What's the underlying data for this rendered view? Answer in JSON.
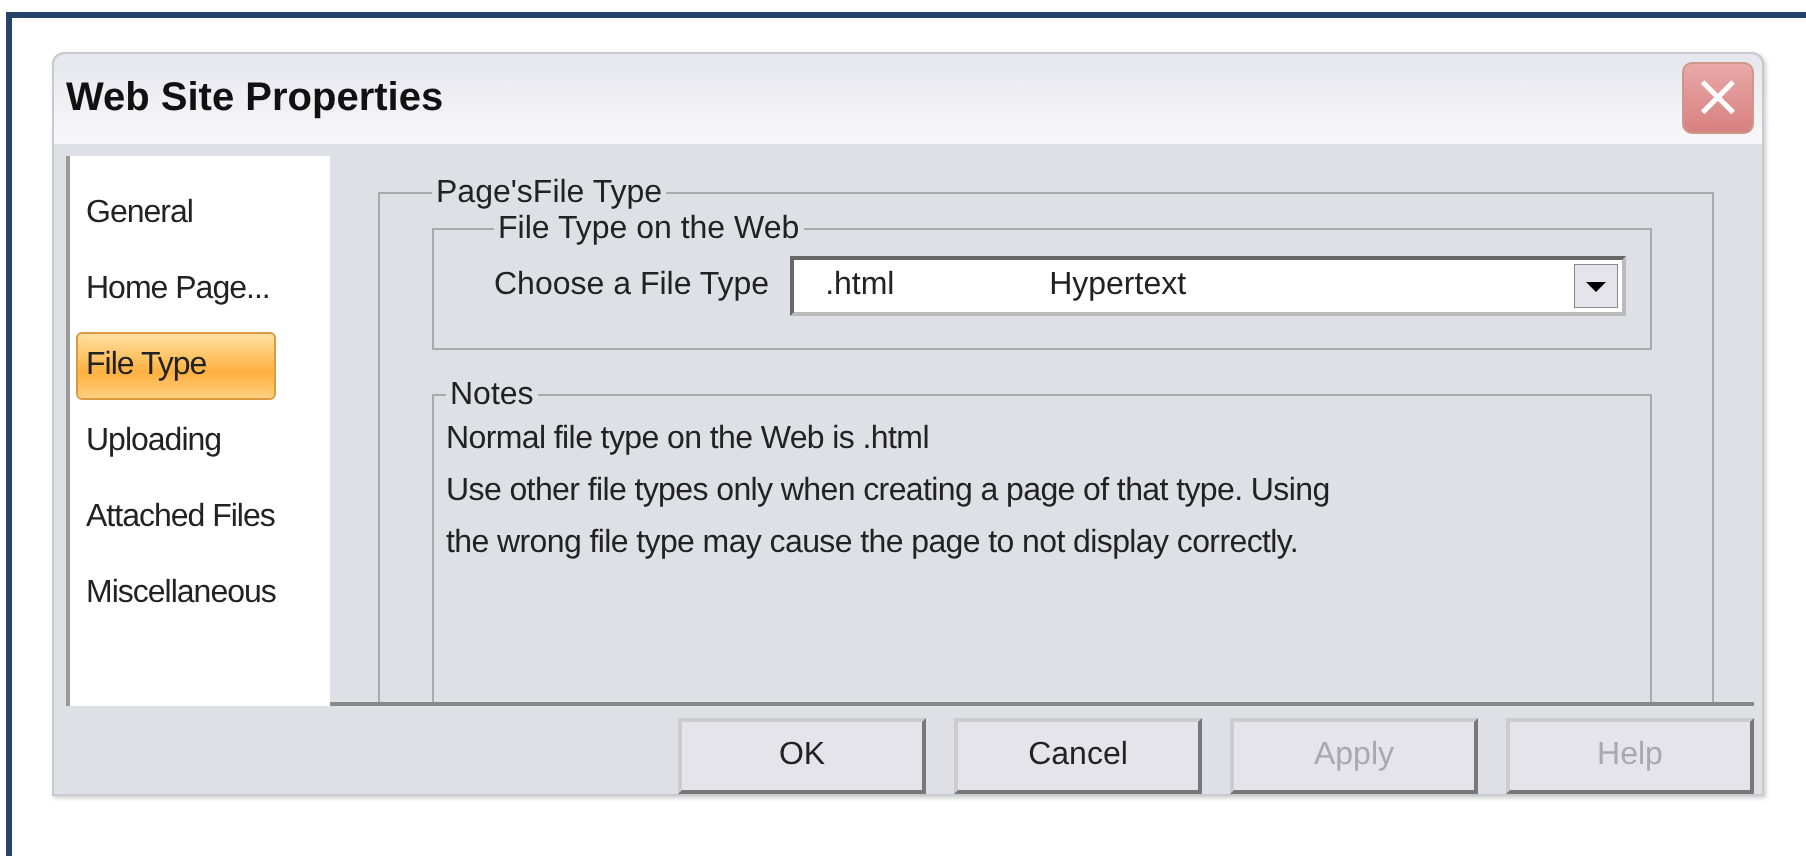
{
  "window": {
    "title": "Web Site Properties",
    "close": "×"
  },
  "sidebar": {
    "items": [
      {
        "label": "General",
        "selected": false
      },
      {
        "label": "Home Page...",
        "selected": false
      },
      {
        "label": "File Type",
        "selected": true
      },
      {
        "label": "Uploading",
        "selected": false
      },
      {
        "label": "Attached Files",
        "selected": false
      },
      {
        "label": "Miscellaneous",
        "selected": false
      }
    ]
  },
  "group": {
    "title": "Page'sFile Type",
    "file_type": {
      "title": "File Type on the Web",
      "label": "Choose a File Type",
      "value": {
        "extension": ".html",
        "description": "Hypertext"
      }
    },
    "notes": {
      "title": "Notes",
      "lines": [
        "Normal file type on the Web is .html",
        "Use other file types only when creating a page of that type. Using",
        "the wrong file type may cause the page to not display correctly."
      ]
    }
  },
  "buttons": [
    {
      "label": "OK",
      "disabled": false
    },
    {
      "label": "Cancel",
      "disabled": false
    },
    {
      "label": "Apply",
      "disabled": true
    },
    {
      "label": "Help",
      "disabled": true
    }
  ]
}
